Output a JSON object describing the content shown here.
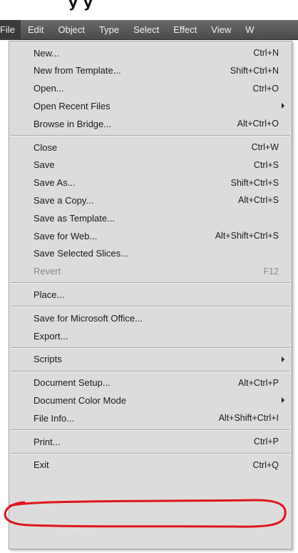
{
  "top_crop_text": "y            y",
  "menubar": [
    "File",
    "Edit",
    "Object",
    "Type",
    "Select",
    "Effect",
    "View",
    "W"
  ],
  "menu": [
    {
      "label": "New...",
      "shortcut": "Ctrl+N"
    },
    {
      "label": "New from Template...",
      "shortcut": "Shift+Ctrl+N"
    },
    {
      "label": "Open...",
      "shortcut": "Ctrl+O"
    },
    {
      "label": "Open Recent Files",
      "shortcut": "",
      "submenu": true
    },
    {
      "label": "Browse in Bridge...",
      "shortcut": "Alt+Ctrl+O"
    },
    {
      "separator": true
    },
    {
      "label": "Close",
      "shortcut": "Ctrl+W"
    },
    {
      "label": "Save",
      "shortcut": "Ctrl+S"
    },
    {
      "label": "Save As...",
      "shortcut": "Shift+Ctrl+S"
    },
    {
      "label": "Save a Copy...",
      "shortcut": "Alt+Ctrl+S"
    },
    {
      "label": "Save as Template...",
      "shortcut": ""
    },
    {
      "label": "Save for Web...",
      "shortcut": "Alt+Shift+Ctrl+S"
    },
    {
      "label": "Save Selected Slices...",
      "shortcut": ""
    },
    {
      "label": "Revert",
      "shortcut": "F12",
      "disabled": true
    },
    {
      "separator": true
    },
    {
      "label": "Place...",
      "shortcut": ""
    },
    {
      "separator": true
    },
    {
      "label": "Save for Microsoft Office...",
      "shortcut": ""
    },
    {
      "label": "Export...",
      "shortcut": ""
    },
    {
      "separator": true
    },
    {
      "label": "Scripts",
      "shortcut": "",
      "submenu": true
    },
    {
      "separator": true
    },
    {
      "label": "Document Setup...",
      "shortcut": "Alt+Ctrl+P"
    },
    {
      "label": "Document Color Mode",
      "shortcut": "",
      "submenu": true
    },
    {
      "label": "File Info...",
      "shortcut": "Alt+Shift+Ctrl+I"
    },
    {
      "separator": true
    },
    {
      "label": "Print...",
      "shortcut": "Ctrl+P",
      "highlighted": true
    },
    {
      "separator": true
    },
    {
      "label": "Exit",
      "shortcut": "Ctrl+Q"
    }
  ],
  "colors": {
    "menubar": "#555555",
    "menu_bg": "#dcdcdc",
    "annotation": "#e0141c"
  }
}
